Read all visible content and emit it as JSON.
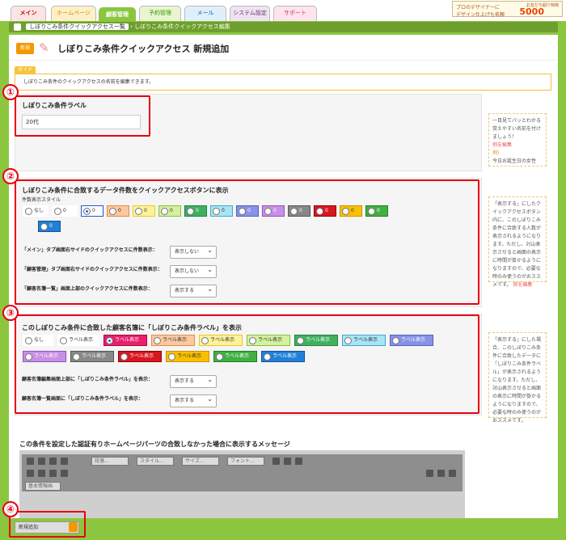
{
  "nav": {
    "tabs": [
      "メイン",
      "ホームページ",
      "顧客管理",
      "予約管理",
      "メール",
      "システム設定",
      "サポート"
    ],
    "promo": {
      "line1": "プロのデザイナーに",
      "line2": "デザイン仕上げも依頼",
      "amount": "5000",
      "lead": "お友だち紹介特典"
    }
  },
  "breadcrumb": [
    "しぼりこみ条件クイックアクセス一覧",
    "しぼりこみ条件クイックアクセス編集"
  ],
  "page": {
    "new_badge": "新規",
    "title": "しぼりこみ条件クイックアクセス 新規追加"
  },
  "guide": {
    "tag": "ガイド",
    "text": "しぼりこみ条件のクイックアクセスの名前を編集できます。"
  },
  "markers": [
    "①",
    "②",
    "③",
    "④"
  ],
  "s1": {
    "heading": "しぼりこみ条件ラベル",
    "value": "20代",
    "side_text": "一目見てパッとわかる覚えやすい名前を付けましょう！",
    "side_link": "例を編集",
    "side_ex_label": "例）",
    "side_ex": "今日お誕生日の女性"
  },
  "s2": {
    "heading": "しぼりこみ条件に合致するデータ件数をクイックアクセスボタンに表示",
    "sub": "件数表示スタイル",
    "styles": [
      {
        "label": "なし",
        "bg": "#ffffff",
        "border": "#ffffff",
        "tc": "#333"
      },
      {
        "label": "0",
        "bg": "#ffffff",
        "border": "#ffffff",
        "tc": "#333"
      },
      {
        "label": "0",
        "bg": "#ffffff",
        "border": "#2255cc",
        "tc": "#333"
      },
      {
        "label": "0",
        "bg": "#fbc8a0",
        "border": "#e88a40",
        "tc": "#333"
      },
      {
        "label": "0",
        "bg": "#fdf19a",
        "border": "#e6cc20",
        "tc": "#333"
      },
      {
        "label": "0",
        "bg": "#d4f0a0",
        "border": "#88c040",
        "tc": "#333"
      },
      {
        "label": "0",
        "bg": "#40b060",
        "border": "#208040",
        "tc": "#fff"
      },
      {
        "label": "0",
        "bg": "#a8e4f4",
        "border": "#40a8d0",
        "tc": "#333"
      },
      {
        "label": "0",
        "bg": "#8892e8",
        "border": "#5060c0",
        "tc": "#fff"
      },
      {
        "label": "0",
        "bg": "#c890e4",
        "border": "#9050c0",
        "tc": "#fff"
      },
      {
        "label": "0",
        "bg": "#888888",
        "border": "#555555",
        "tc": "#fff"
      },
      {
        "label": "0",
        "bg": "#d81820",
        "border": "#900000",
        "tc": "#fff"
      },
      {
        "label": "0",
        "bg": "#f8c000",
        "border": "#d09000",
        "tc": "#333"
      },
      {
        "label": "0",
        "bg": "#40b040",
        "border": "#208020",
        "tc": "#fff"
      },
      {
        "label": "0",
        "bg": "#2080d8",
        "border": "#1050a0",
        "tc": "#fff"
      }
    ],
    "rows": [
      {
        "label": "「メイン」タブ画面右サイドのクイックアクセスに件数表示：",
        "value": "表示しない"
      },
      {
        "label": "「顧客管理」タブ画面右サイドのクイックアクセスに件数表示：",
        "value": "表示しない"
      },
      {
        "label": "「顧客名簿一覧」画面上部のクイックアクセスに件数表示：",
        "value": "表示する"
      }
    ],
    "side_text": "「表示する」にしたクイックアクセスボタン内に、このしぼりこみ条件に合致する人数が表示されるようになります。ただし、対山表示させると画面の表示に時間が掛かるようになりますので、必要な時のみ使うのがおススメです。",
    "side_link": "例を編集"
  },
  "s3": {
    "heading": "このしぼりこみ条件に合致した顧客名簿に「しぼりこみ条件ラベル」を表示",
    "styles": [
      {
        "label": "なし",
        "bg": "#ffffff",
        "border": "#ffffff",
        "tc": "#333"
      },
      {
        "label": "ラベル表示",
        "bg": "#ffffff",
        "border": "#ffffff",
        "tc": "#333"
      },
      {
        "label": "ラベル表示",
        "bg": "#e8206c",
        "border": "#b00040",
        "tc": "#fff"
      },
      {
        "label": "ラベル表示",
        "bg": "#fbc8a0",
        "border": "#e88a40",
        "tc": "#333"
      },
      {
        "label": "ラベル表示",
        "bg": "#fdf19a",
        "border": "#e6cc20",
        "tc": "#333"
      },
      {
        "label": "ラベル表示",
        "bg": "#d4f0a0",
        "border": "#88c040",
        "tc": "#333"
      },
      {
        "label": "ラベル表示",
        "bg": "#40b060",
        "border": "#208040",
        "tc": "#fff"
      },
      {
        "label": "ラベル表示",
        "bg": "#a8e4f4",
        "border": "#40a8d0",
        "tc": "#333"
      },
      {
        "label": "ラベル表示",
        "bg": "#8892e8",
        "border": "#5060c0",
        "tc": "#fff"
      },
      {
        "label": "ラベル表示",
        "bg": "#c890e4",
        "border": "#9050c0",
        "tc": "#fff"
      },
      {
        "label": "ラベル表示",
        "bg": "#888888",
        "border": "#555555",
        "tc": "#fff"
      },
      {
        "label": "ラベル表示",
        "bg": "#d81820",
        "border": "#900000",
        "tc": "#fff"
      },
      {
        "label": "ラベル表示",
        "bg": "#f8c000",
        "border": "#d09000",
        "tc": "#333"
      },
      {
        "label": "ラベル表示",
        "bg": "#40b040",
        "border": "#208020",
        "tc": "#fff"
      },
      {
        "label": "ラベル表示",
        "bg": "#2080d8",
        "border": "#1050a0",
        "tc": "#fff"
      }
    ],
    "rows": [
      {
        "label": "顧客名簿編集画面上部に「しぼりこみ条件ラベル」を表示：",
        "value": "表示する"
      },
      {
        "label": "顧客名簿一覧画面に「しぼりこみ条件ラベル」を表示：",
        "value": "表示する"
      }
    ],
    "side_text": "「表示する」にした場合、このしぼりこみ条件に合致したデータに「しぼりこみ条件ラベル」が表示されるようになります。ただし、対山表示させると画面の表示に時間が掛かるようになりますので、必要な時のみ使うのがおススメです。"
  },
  "s4": {
    "heading": "この条件を設定した認証有りホームページパーツの合致しなかった場合に表示するメッセージ",
    "toolbar": [
      "段落...",
      "スタイル...",
      "サイズ...",
      "フォント...",
      "基本情報画"
    ]
  },
  "footer": {
    "add_button": "新規追加"
  }
}
